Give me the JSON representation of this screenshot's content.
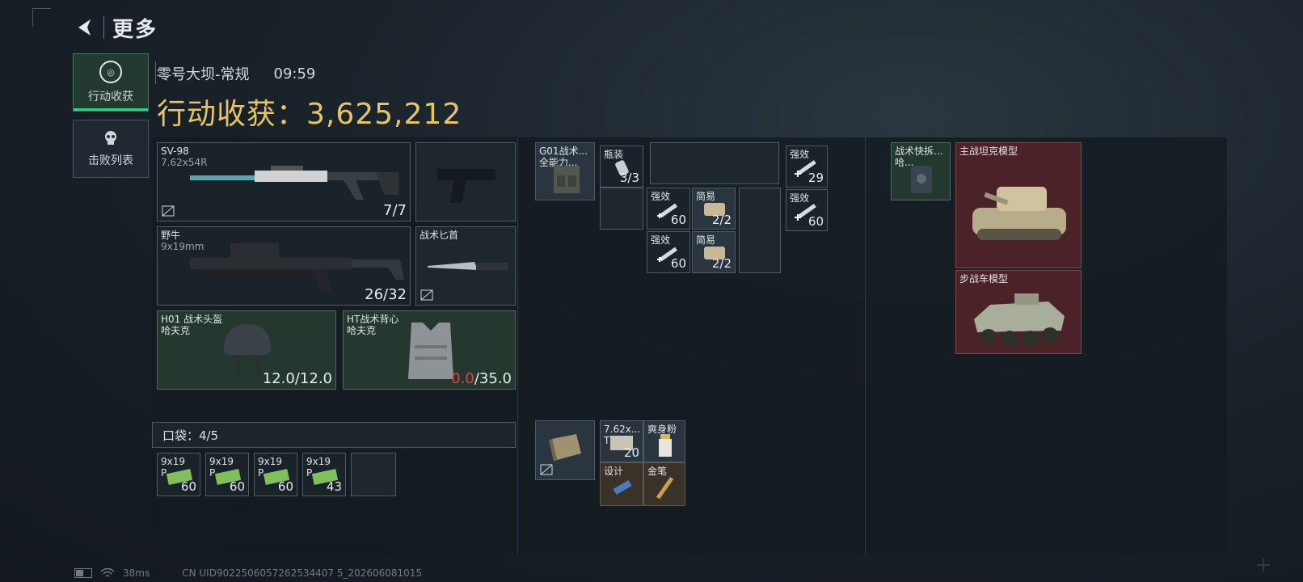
{
  "header": {
    "back_label": "更多"
  },
  "tabs": [
    {
      "label": "行动收获",
      "active": true
    },
    {
      "label": "击败列表",
      "active": false
    }
  ],
  "map": {
    "name": "零号大坝-常规",
    "time": "09:59"
  },
  "loot": {
    "title": "行动收获：3,625,212"
  },
  "weapons": {
    "primary": {
      "name": "SV-98",
      "ammo": "7.62x54R",
      "count": "7/7"
    },
    "secondary": {
      "name": "野牛",
      "ammo": "9x19mm",
      "count": "26/32"
    },
    "melee": {
      "name": "战术匕首"
    },
    "helmet": {
      "name": "H01 战术头盔",
      "brand": "哈夫克",
      "dur_cur": "12.0",
      "dur_max": "/12.0"
    },
    "armor": {
      "name": "HT战术背心",
      "brand": "哈夫克",
      "dur_cur": "0.0",
      "dur_max": "/35.0"
    }
  },
  "pocket": {
    "label": "口袋：4/5",
    "items": [
      {
        "name": "9x19",
        "sub": "P",
        "count": "60"
      },
      {
        "name": "9x19",
        "sub": "P",
        "count": "60"
      },
      {
        "name": "9x19",
        "sub": "P",
        "count": "60"
      },
      {
        "name": "9x19",
        "sub": "P",
        "count": "43"
      }
    ]
  },
  "chest_rig": {
    "rig_name": "G01战术...",
    "rig_sub": "全能力...",
    "items": [
      {
        "name": "瓶装",
        "count": "3/3"
      },
      {
        "name": "强效",
        "count": "60"
      },
      {
        "name": "简易",
        "count": "2/2"
      },
      {
        "name": "强效",
        "count": "60"
      },
      {
        "name": "简易",
        "count": "2/2"
      },
      {
        "name": "强效",
        "count": "29"
      },
      {
        "name": "强效",
        "count": "60"
      }
    ]
  },
  "backpack_items": [
    {
      "name": "7.62x...",
      "sub": "T",
      "count": "20"
    },
    {
      "name": "爽身粉"
    },
    {
      "name": "设计"
    },
    {
      "name": "金笔"
    }
  ],
  "safe_box": {
    "case_name": "战术快拆...",
    "case_sub": "哈...",
    "items": [
      {
        "name": "主战坦克模型"
      },
      {
        "name": "步战车模型"
      }
    ]
  },
  "footer": {
    "ping": "38ms",
    "uid": "CN UID9022506057262534407 5_202606081015"
  },
  "colors": {
    "accent_gold": "#e6c56a",
    "active_green": "#2fd08a",
    "durability_broken": "#e2453e"
  }
}
